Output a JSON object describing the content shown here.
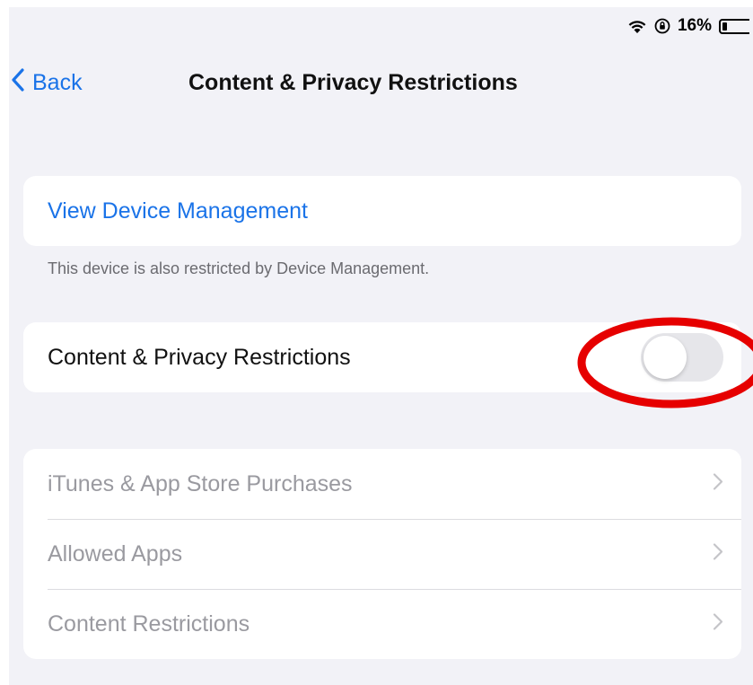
{
  "status_bar": {
    "battery_percent": "16%",
    "icons": [
      "wifi-icon",
      "orientation-lock-icon",
      "battery-icon"
    ]
  },
  "nav": {
    "back_label": "Back",
    "title": "Content & Privacy Restrictions"
  },
  "device_management": {
    "link_label": "View Device Management",
    "footer": "This device is also restricted by Device Management."
  },
  "restrictions_toggle": {
    "label": "Content & Privacy Restrictions",
    "enabled": false
  },
  "menu": {
    "items": [
      {
        "label": "iTunes & App Store Purchases"
      },
      {
        "label": "Allowed Apps"
      },
      {
        "label": "Content Restrictions"
      }
    ]
  },
  "colors": {
    "accent": "#1a73e8",
    "background": "#f2f2f7",
    "annotation": "#e60000"
  }
}
